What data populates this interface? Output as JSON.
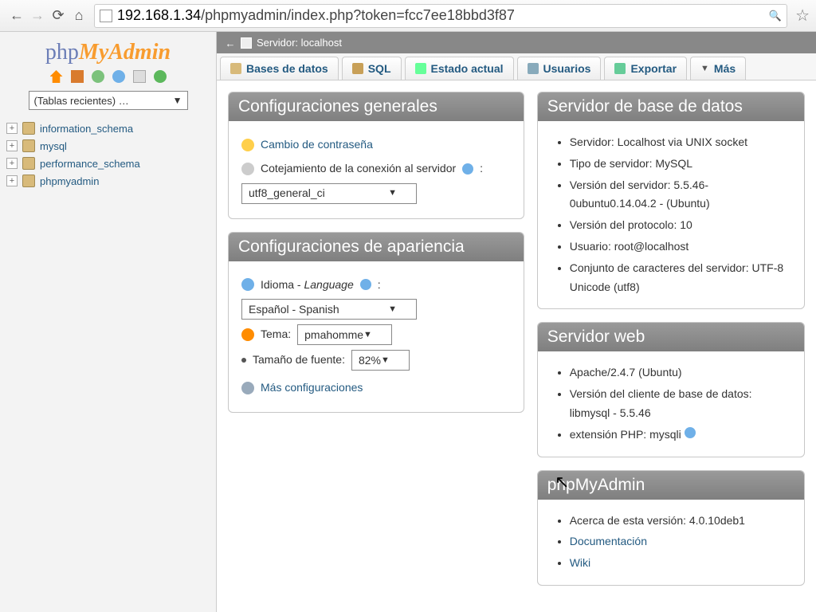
{
  "browser": {
    "url_host": "192.168.1.34",
    "url_path": "/phpmyadmin/index.php?token=fcc7ee18bbd3f87"
  },
  "logo": {
    "php": "php",
    "my": "My",
    "admin": "Admin"
  },
  "sidebar": {
    "recent_label": "(Tablas recientes) …",
    "databases": [
      "information_schema",
      "mysql",
      "performance_schema",
      "phpmyadmin"
    ]
  },
  "server_bar": {
    "label": "Servidor: localhost"
  },
  "tabs": {
    "databases": "Bases de datos",
    "sql": "SQL",
    "status": "Estado actual",
    "users": "Usuarios",
    "export": "Exportar",
    "more": "Más"
  },
  "panels": {
    "general": {
      "title": "Configuraciones generales",
      "change_pw": "Cambio de contraseña",
      "collation_label": "Cotejamiento de la conexión al servidor",
      "collation_value": "utf8_general_ci"
    },
    "appearance": {
      "title": "Configuraciones de apariencia",
      "language_label": "Idioma - ",
      "language_label_italic": "Language",
      "language_value": "Español - Spanish",
      "theme_label": "Tema:",
      "theme_value": "pmahomme",
      "fontsize_label": "Tamaño de fuente:",
      "fontsize_value": "82%",
      "more_settings": "Más configuraciones"
    },
    "dbserver": {
      "title": "Servidor de base de datos",
      "items": [
        "Servidor: Localhost via UNIX socket",
        "Tipo de servidor: MySQL",
        "Versión del servidor: 5.5.46-0ubuntu0.14.04.2 - (Ubuntu)",
        "Versión del protocolo: 10",
        "Usuario: root@localhost",
        "Conjunto de caracteres del servidor: UTF-8 Unicode (utf8)"
      ]
    },
    "webserver": {
      "title": "Servidor web",
      "item1": "Apache/2.4.7 (Ubuntu)",
      "item2": "Versión del cliente de base de datos: libmysql - 5.5.46",
      "item3_label": "extensión PHP: mysqli"
    },
    "pma": {
      "title": "phpMyAdmin",
      "version_label": "Acerca de esta versión: 4.0.10deb1",
      "docs": "Documentación",
      "wiki": "Wiki"
    }
  }
}
